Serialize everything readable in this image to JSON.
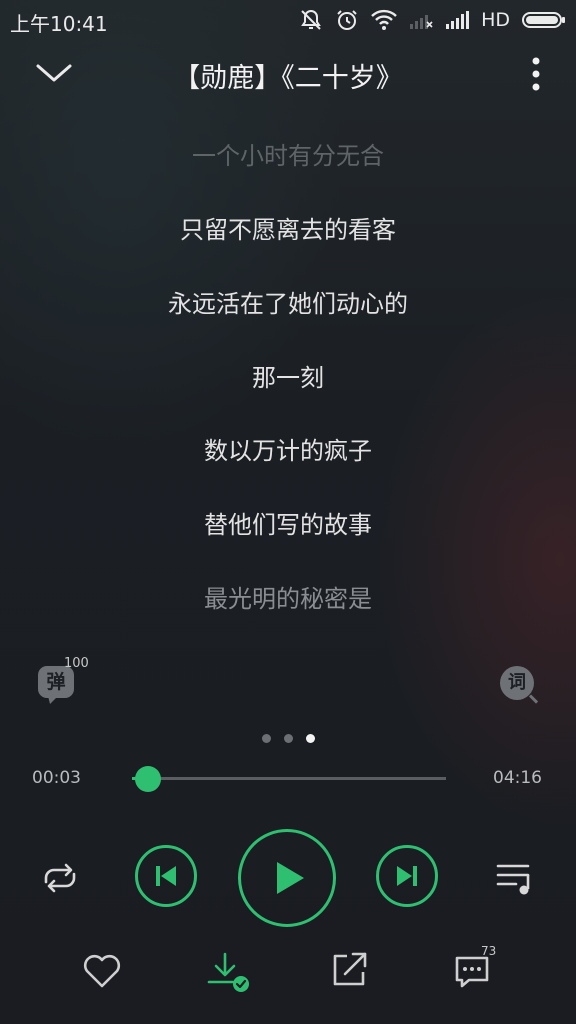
{
  "status_bar": {
    "time": "上午10:41",
    "network": "HD",
    "icons": [
      "mute-icon",
      "alarm-icon",
      "wifi-icon",
      "signal-empty-icon",
      "signal-icon",
      "battery-icon"
    ]
  },
  "header": {
    "back_icon": "chevron-down-icon",
    "title": "【勋鹿】《二十岁》",
    "more_icon": "more-vertical-icon"
  },
  "lyrics": [
    {
      "text": "一个小时有分无合",
      "state": "dim"
    },
    {
      "text": "只留不愿离去的看客",
      "state": "normal"
    },
    {
      "text": "永远活在了她们动心的",
      "state": "normal"
    },
    {
      "text": "那一刻",
      "state": "normal"
    },
    {
      "text": "数以万计的疯子",
      "state": "normal"
    },
    {
      "text": "替他们写的故事",
      "state": "normal"
    },
    {
      "text": "最光明的秘密是",
      "state": "mid"
    }
  ],
  "danmu": {
    "label": "弹",
    "count": "100"
  },
  "lyric_search": {
    "label": "词"
  },
  "pager": {
    "count": 3,
    "active": 2
  },
  "progress": {
    "current": "00:03",
    "duration": "04:16",
    "fraction": 0.05
  },
  "controls": {
    "loop_icon": "repeat-icon",
    "prev_icon": "skip-previous-icon",
    "play_icon": "play-icon",
    "next_icon": "skip-next-icon",
    "playlist_icon": "playlist-icon"
  },
  "actions": {
    "like_icon": "heart-icon",
    "download_icon": "download-done-icon",
    "share_icon": "share-icon",
    "comment_icon": "comment-icon",
    "comment_count": "73"
  },
  "colors": {
    "accent": "#2fbf71",
    "background": "#1b1f24"
  }
}
